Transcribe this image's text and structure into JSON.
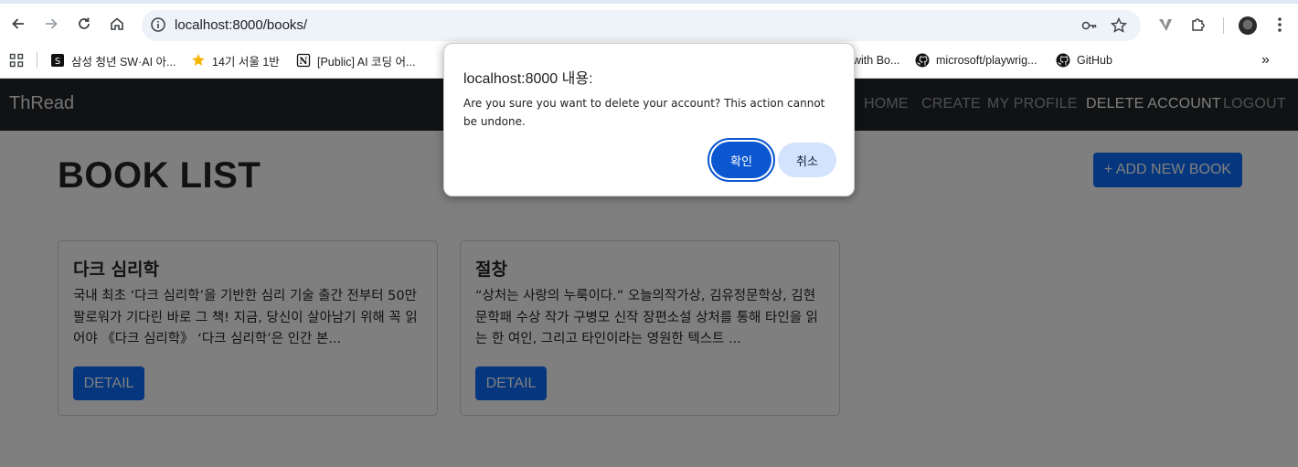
{
  "browser": {
    "url": "localhost:8000/books/",
    "bookmarks": [
      {
        "label": "삼성 청년 SW·AI 아...",
        "icon": "ssafy-icon"
      },
      {
        "label": "14기 서울 1반",
        "icon": "star-icon"
      },
      {
        "label": "[Public] AI 코딩 어...",
        "icon": "notion-icon"
      },
      {
        "label": "with Bo...",
        "icon": "bookmark-icon"
      },
      {
        "label": "microsoft/playwrig...",
        "icon": "github-icon"
      },
      {
        "label": "GitHub",
        "icon": "github-icon"
      }
    ],
    "more_bookmarks": "»"
  },
  "navbar": {
    "brand": "ThRead",
    "links": [
      "HOME",
      "CREATE",
      "MY PROFILE",
      "DELETE ACCOUNT",
      "LOGOUT"
    ],
    "active_link": "DELETE ACCOUNT"
  },
  "main": {
    "title": "BOOK LIST",
    "add_button": "+ ADD NEW BOOK",
    "books": [
      {
        "title": "다크 심리학",
        "description": "국내 최초 ‘다크 심리학’을 기반한 심리 기술 출간 전부터 50만 팔로워가 기다린 바로 그 책! 지금, 당신이 살아남기 위해 꼭 읽어야 《다크 심리학》 ‘다크 심리학’은 인간 본...",
        "button": "DETAIL"
      },
      {
        "title": "절창",
        "description": "“상처는 사랑의 누룩이다.” 오늘의작가상, 김유정문학상, 김현문학패 수상 작가 구병모 신작 장편소설 상처를 통해 타인을 읽는 한 여인, 그리고 타인이라는 영원한 텍스트 ...",
        "button": "DETAIL"
      }
    ]
  },
  "dialog": {
    "title": "localhost:8000 내용:",
    "message": "Are you sure you want to delete your account? This action cannot be undone.",
    "ok": "확인",
    "cancel": "취소"
  },
  "colors": {
    "navbar_bg": "#212529",
    "primary": "#0d6efd",
    "dialog_ok": "#0b57d0",
    "dialog_cancel": "#d3e3fd"
  }
}
